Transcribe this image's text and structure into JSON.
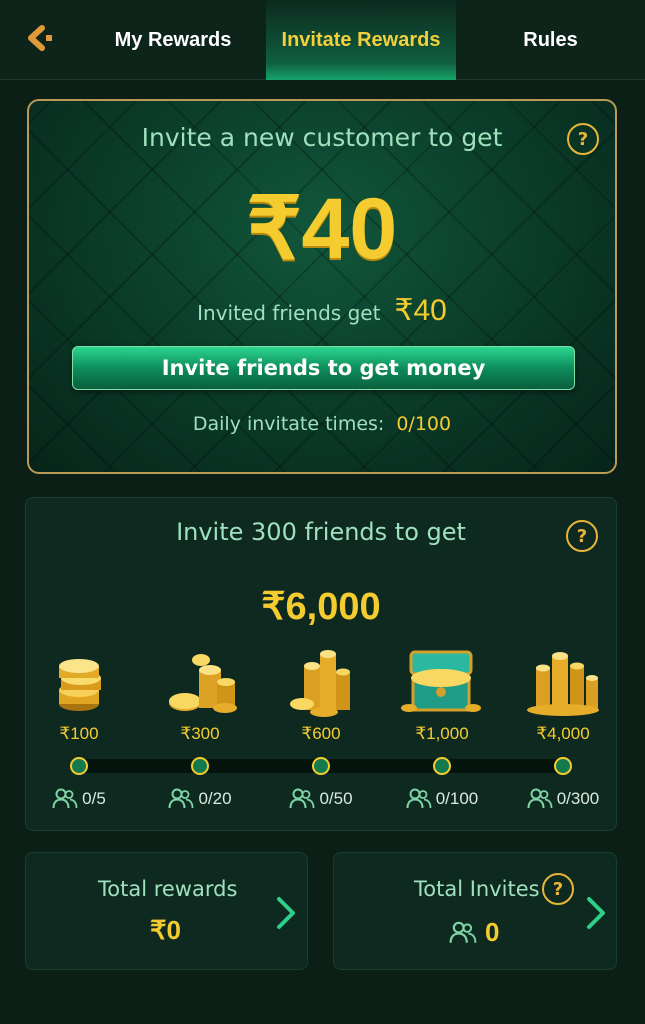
{
  "header": {
    "tabs": [
      {
        "label": "My Rewards"
      },
      {
        "label": "Invitate Rewards",
        "active": true
      },
      {
        "label": "Rules"
      }
    ]
  },
  "invite_card": {
    "headline": "Invite a new customer to get",
    "amount": "₹40",
    "friends_label": "Invited friends get",
    "friends_amount": "₹40",
    "button_label": "Invite friends to get money",
    "daily_label": "Daily invitate times:",
    "daily_value": "0/100"
  },
  "milestone_card": {
    "headline": "Invite 300 friends to get",
    "amount": "₹6,000",
    "milestones": [
      {
        "reward": "₹100",
        "count": "0/5",
        "icon": "coin-stack-icon"
      },
      {
        "reward": "₹300",
        "count": "0/20",
        "icon": "coin-pile-icon"
      },
      {
        "reward": "₹600",
        "count": "0/50",
        "icon": "coin-tower-icon"
      },
      {
        "reward": "₹1,000",
        "count": "0/100",
        "icon": "treasure-chest-icon"
      },
      {
        "reward": "₹4,000",
        "count": "0/300",
        "icon": "coin-heap-icon"
      }
    ]
  },
  "totals": {
    "rewards_label": "Total rewards",
    "rewards_value": "₹0",
    "invites_label": "Total Invites",
    "invites_value": "0"
  },
  "colors": {
    "gold": "#f5cc2f",
    "mint_text": "#9fe0be",
    "accent_green": "#17a46b",
    "background": "#0b1f17"
  }
}
